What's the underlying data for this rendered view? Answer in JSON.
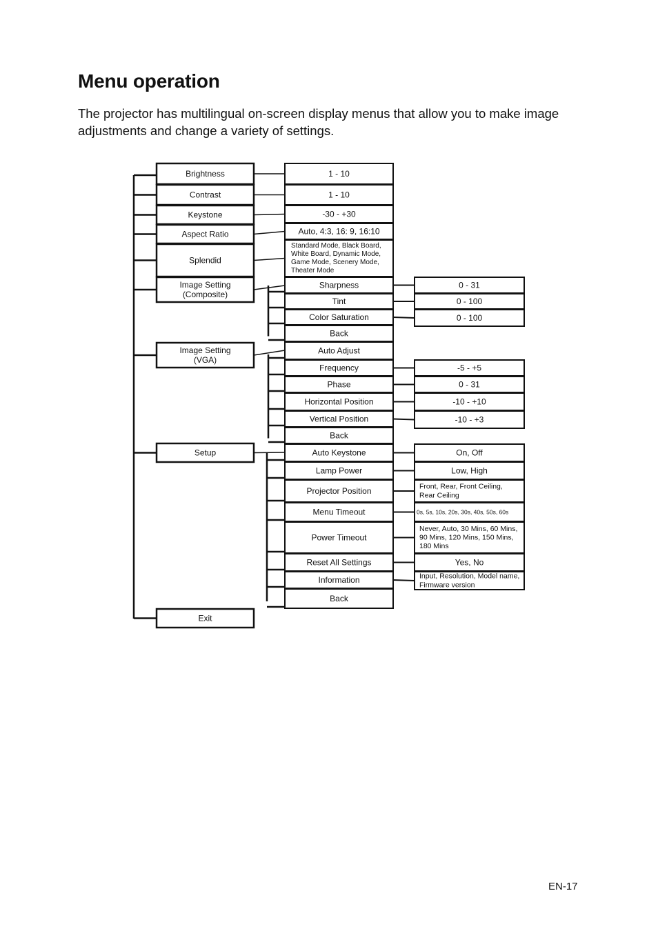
{
  "page": {
    "title": "Menu operation",
    "intro": "The projector has multilingual on-screen display menus that allow you to make image adjustments and change a variety of settings.",
    "page_number": "EN-17"
  },
  "menu_tree": {
    "main_menu": [
      {
        "label": [
          "Brightness"
        ],
        "options": [
          {
            "label": [
              "1 - 10"
            ]
          }
        ]
      },
      {
        "label": [
          "Contrast"
        ],
        "options": [
          {
            "label": [
              "1 - 10"
            ]
          }
        ]
      },
      {
        "label": [
          "Keystone"
        ],
        "options": [
          {
            "label": [
              "-30 - +30"
            ]
          }
        ]
      },
      {
        "label": [
          "Aspect Ratio"
        ],
        "options": [
          {
            "label": [
              "Auto, 4:3, 16: 9, 16:10"
            ]
          }
        ]
      },
      {
        "label": [
          "Splendid"
        ],
        "options": [
          {
            "label": [
              "Standard Mode, Black Board,",
              "White Board, Dynamic Mode,",
              "Game Mode, Scenery Mode,",
              "Theater Mode"
            ]
          }
        ]
      },
      {
        "label": [
          "Image Setting",
          "(Composite)"
        ],
        "submenu": [
          {
            "label": [
              "Sharpness"
            ],
            "values": [
              "0 - 31"
            ]
          },
          {
            "label": [
              "Tint"
            ],
            "values": [
              "0 - 100"
            ]
          },
          {
            "label": [
              "Color Saturation"
            ],
            "values": [
              "0 - 100"
            ]
          },
          {
            "label": [
              "Back"
            ]
          }
        ]
      },
      {
        "label": [
          "Image Setting",
          "(VGA)"
        ],
        "submenu": [
          {
            "label": [
              "Auto Adjust"
            ]
          },
          {
            "label": [
              "Frequency"
            ],
            "values": [
              "-5 - +5"
            ]
          },
          {
            "label": [
              "Phase"
            ],
            "values": [
              "0 - 31"
            ]
          },
          {
            "label": [
              "Horizontal Position"
            ],
            "values": [
              "-10 - +10"
            ]
          },
          {
            "label": [
              "Vertical Position"
            ],
            "values": [
              "-10 - +3"
            ]
          },
          {
            "label": [
              "Back"
            ]
          }
        ]
      },
      {
        "label": [
          "Setup"
        ],
        "submenu": [
          {
            "label": [
              "Auto Keystone"
            ],
            "values": [
              "On, Off"
            ]
          },
          {
            "label": [
              "Lamp Power"
            ],
            "values": [
              "Low, High"
            ]
          },
          {
            "label": [
              "Projector Position"
            ],
            "values": [
              "Front, Rear, Front Ceiling,",
              "Rear Ceiling"
            ]
          },
          {
            "label": [
              "Menu Timeout"
            ],
            "values": [
              "0s, 5s, 10s, 20s, 30s,  40s, 50s, 60s"
            ]
          },
          {
            "label": [
              "Power Timeout"
            ],
            "values": [
              "Never, Auto, 30 Mins, 60 Mins,",
              "90 Mins, 120 Mins, 150 Mins,",
              "180 Mins"
            ]
          },
          {
            "label": [
              "Reset All Settings"
            ],
            "values": [
              "Yes, No"
            ]
          },
          {
            "label": [
              "Information"
            ],
            "values": [
              "Input, Resolution, Model name,",
              "Firmware version"
            ]
          },
          {
            "label": [
              "Back"
            ]
          }
        ]
      },
      {
        "label": [
          "Exit"
        ]
      }
    ]
  }
}
